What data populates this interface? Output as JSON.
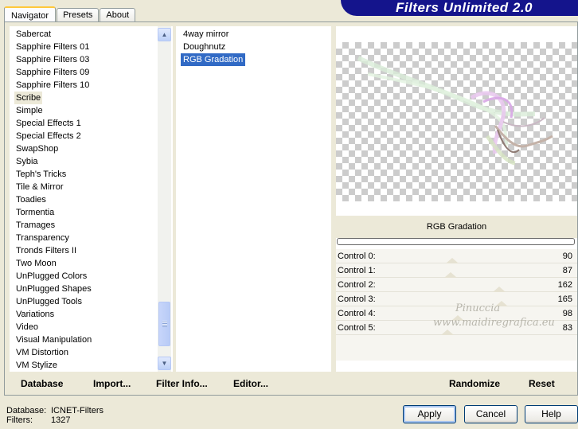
{
  "tabs": [
    "Navigator",
    "Presets",
    "About"
  ],
  "logo": "Filters Unlimited 2.0",
  "categories": [
    "Sabercat",
    "Sapphire Filters 01",
    "Sapphire Filters 03",
    "Sapphire Filters 09",
    "Sapphire Filters 10",
    "Scribe",
    "Simple",
    "Special Effects 1",
    "Special Effects 2",
    "SwapShop",
    "Sybia",
    "Teph's Tricks",
    "Tile & Mirror",
    "Toadies",
    "Tormentia",
    "Tramages",
    "Transparency",
    "Tronds Filters II",
    "Two Moon",
    "UnPlugged Colors",
    "UnPlugged Shapes",
    "UnPlugged Tools",
    "Variations",
    "Video",
    "Visual Manipulation",
    "VM Distortion",
    "VM Stylize"
  ],
  "selected_category_index": 5,
  "filters": [
    "4way mirror",
    "Doughnutz",
    "RGB Gradation"
  ],
  "selected_filter_index": 2,
  "preview": {
    "filter_name": "RGB Gradation",
    "progress": 0
  },
  "controls": [
    {
      "label": "Control 0:",
      "value": 90
    },
    {
      "label": "Control 1:",
      "value": 87
    },
    {
      "label": "Control 2:",
      "value": 162
    },
    {
      "label": "Control 3:",
      "value": 165
    },
    {
      "label": "Control 4:",
      "value": 98
    },
    {
      "label": "Control 5:",
      "value": 83
    }
  ],
  "watermark": {
    "line1": "Pinuccia",
    "line2": "www.maidiregrafica.eu"
  },
  "toolbar": {
    "database": "Database",
    "import": "Import...",
    "filter_info": "Filter Info...",
    "editor": "Editor...",
    "randomize": "Randomize",
    "reset": "Reset"
  },
  "status": {
    "database_label": "Database:",
    "database_value": "ICNET-Filters",
    "filters_label": "Filters:",
    "filters_value": "1327"
  },
  "buttons": {
    "apply": "Apply",
    "cancel": "Cancel",
    "help": "Help"
  }
}
